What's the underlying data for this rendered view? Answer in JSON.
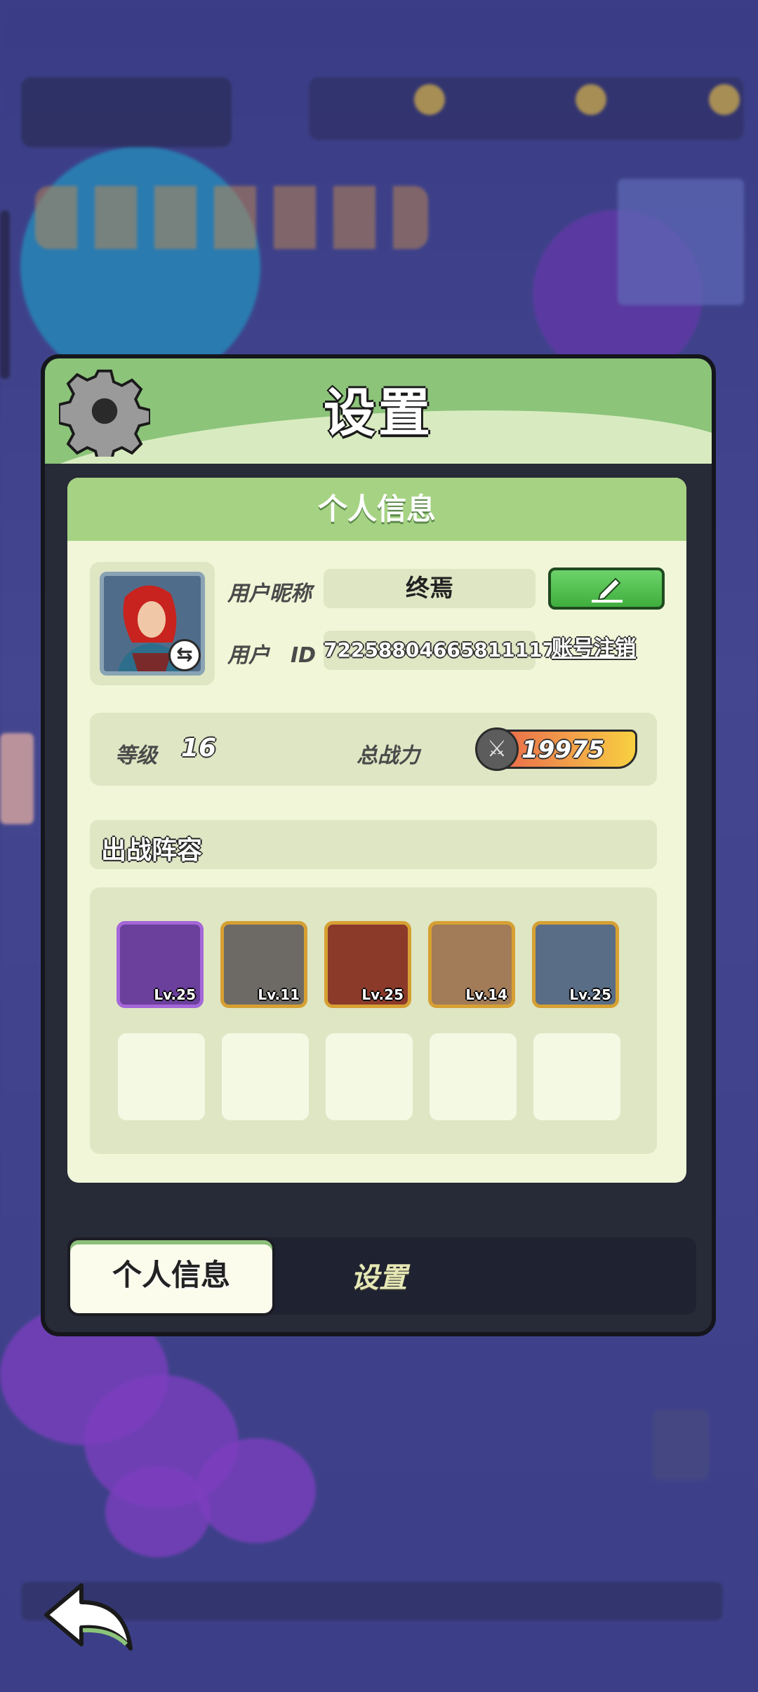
{
  "dialog": {
    "title": "设置",
    "section_title": "个人信息",
    "nickname_label": "用户昵称",
    "nickname_value": "终焉",
    "id_label": "用户　ID",
    "id_value": "72258804665811117",
    "account_cancel_link": "账号注销",
    "level_label": "等级",
    "level_value": "16",
    "power_label": "总战力",
    "power_value": "19975",
    "lineup_title": "出战阵容",
    "heroes": [
      {
        "level": "Lv.25",
        "rarity": "purple",
        "color": "#6b3f9c"
      },
      {
        "level": "Lv.11",
        "rarity": "gold",
        "color": "#6d6a66"
      },
      {
        "level": "Lv.25",
        "rarity": "gold",
        "color": "#8b3a2a"
      },
      {
        "level": "Lv.14",
        "rarity": "gold",
        "color": "#a27c58"
      },
      {
        "level": "Lv.25",
        "rarity": "gold",
        "color": "#5a6d86"
      }
    ],
    "empty_slots": 5
  },
  "tabs": [
    {
      "label": "个人信息",
      "active": true
    },
    {
      "label": "设置",
      "active": false
    }
  ],
  "icons": {
    "gear": "gear-icon",
    "edit": "pencil-icon",
    "swap": "swap-icon",
    "power": "crossed-swords-icon",
    "back": "back-arrow-icon"
  },
  "colors": {
    "accent_green": "#8cc47a",
    "panel_bg": "#f0f6d7",
    "edit_button": "#4fc14c"
  }
}
